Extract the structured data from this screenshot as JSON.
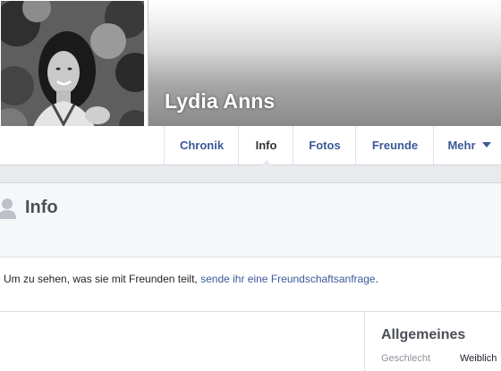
{
  "profile": {
    "name": "Lydia Anns"
  },
  "nav": {
    "tabs": [
      {
        "label": "Chronik"
      },
      {
        "label": "Info"
      },
      {
        "label": "Fotos"
      },
      {
        "label": "Freunde"
      },
      {
        "label": "Mehr"
      }
    ],
    "active_tab": "Info"
  },
  "info": {
    "title": "Info"
  },
  "message": {
    "text_before": "Um zu sehen, was sie mit Freunden teilt, ",
    "link": "sende ihr eine Freundschaftsanfrage",
    "text_after": "."
  },
  "sections": {
    "general": {
      "title": "Allgemeines",
      "fields": [
        {
          "label": "Geschlecht",
          "value": "Weiblich"
        }
      ]
    }
  },
  "colors": {
    "link": "#3b5998",
    "page_gray": "#e9eaed"
  }
}
